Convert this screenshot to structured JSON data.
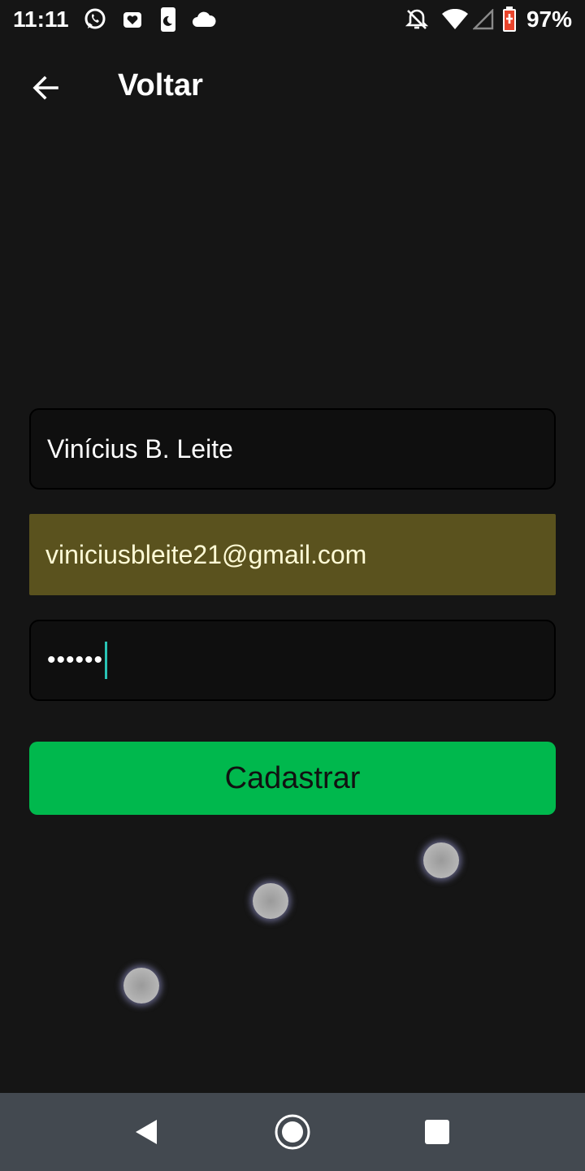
{
  "status_bar": {
    "time": "11:11",
    "battery_percent": "97%",
    "left_icons": [
      "whatsapp-icon",
      "sleep-tracker-icon",
      "phone-moon-icon",
      "cloud-icon"
    ],
    "right_icons": [
      "notifications-off-icon",
      "wifi-icon",
      "cellular-signal-icon",
      "battery-charging-icon"
    ]
  },
  "app_bar": {
    "title": "Voltar",
    "back_icon": "arrow-left-icon"
  },
  "form": {
    "name_value": "Vinícius B. Leite",
    "email_value": "viniciusbleite21@gmail.com",
    "password_masked": "••••••",
    "submit_label": "Cadastrar"
  },
  "colors": {
    "background": "#151515",
    "field_background": "#0f0f0f",
    "autofill_background": "#5a521e",
    "accent_green": "#00b84d",
    "caret": "#29c3b5",
    "nav_bar": "#434950"
  },
  "nav_bar": {
    "icons": [
      "nav-back-icon",
      "nav-home-icon",
      "nav-recents-icon"
    ]
  }
}
